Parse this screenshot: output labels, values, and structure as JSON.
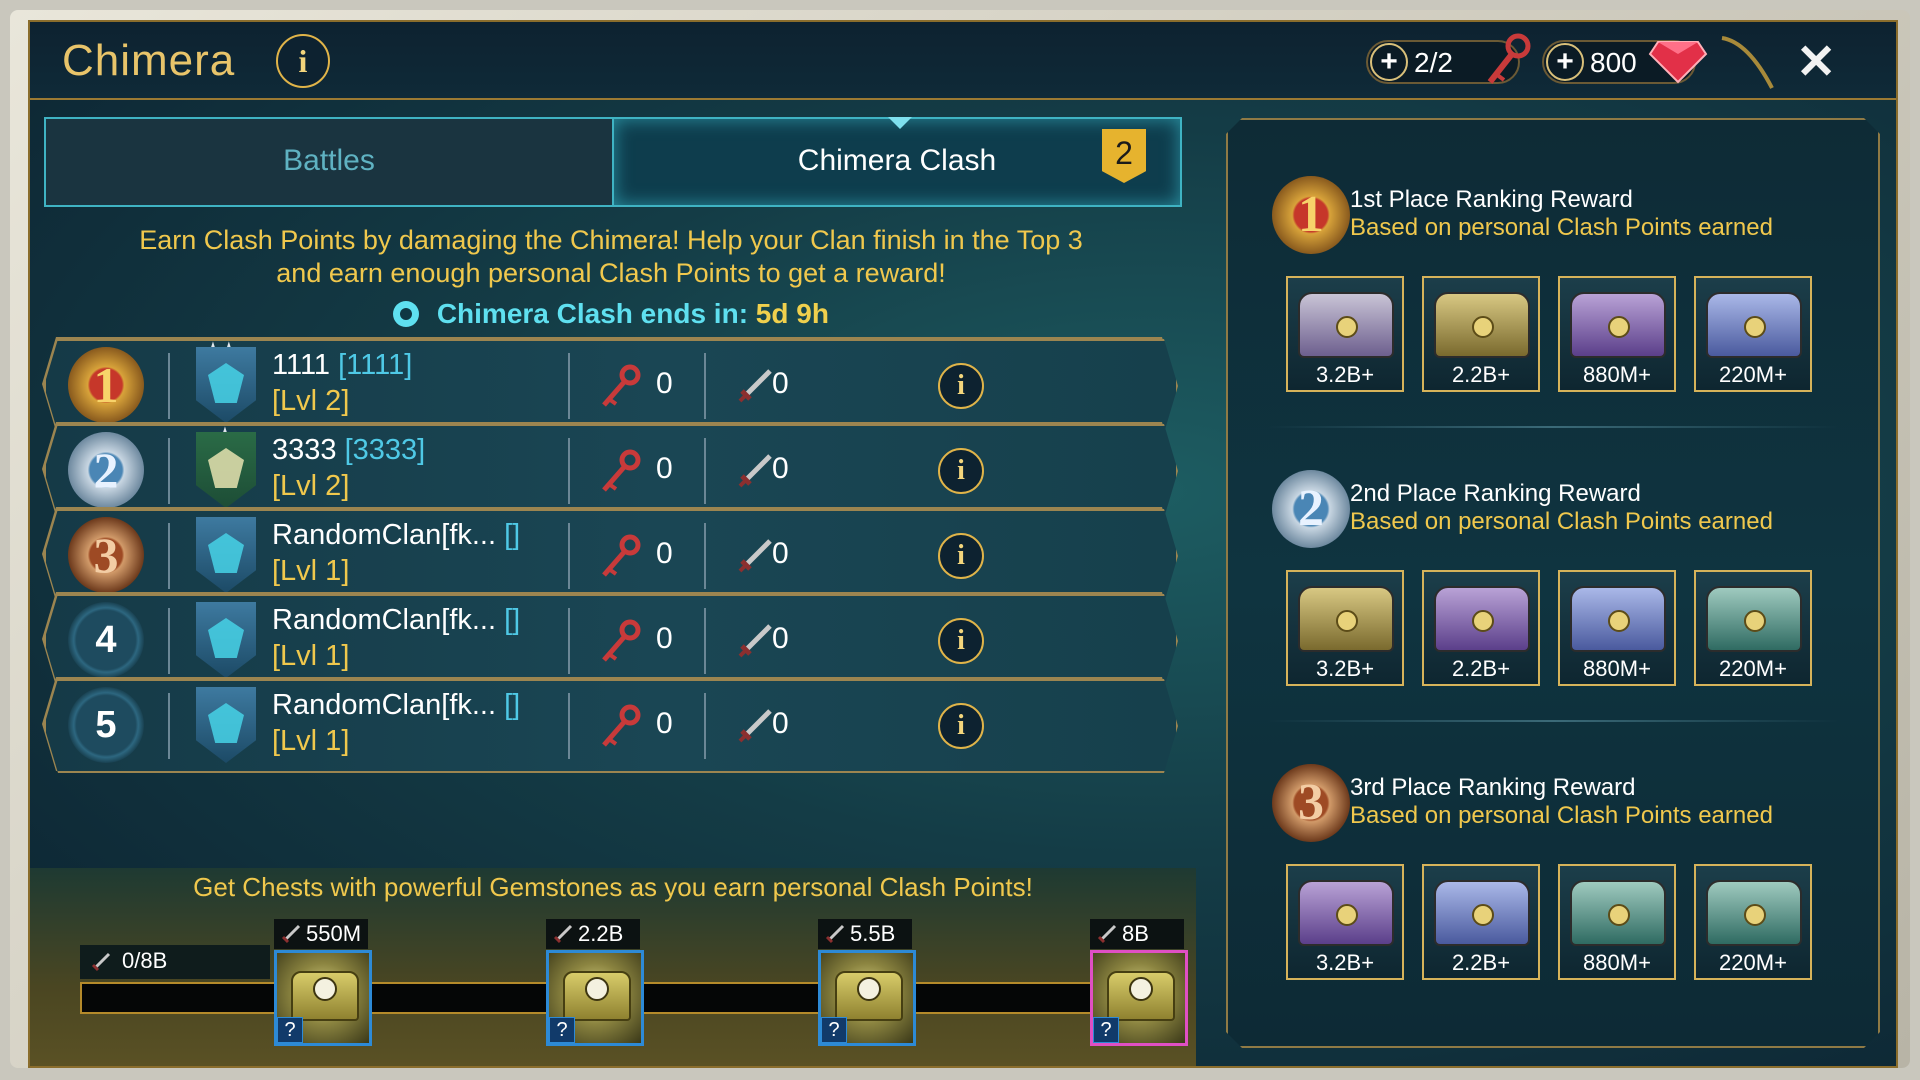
{
  "header": {
    "title": "Chimera",
    "keys": "2/2",
    "gems": "800",
    "close": "✕"
  },
  "tabs": {
    "battles": "Battles",
    "clash": "Chimera Clash",
    "clash_badge": "2"
  },
  "description": {
    "line1": "Earn Clash Points by damaging the Chimera! Help your Clan finish in the Top 3",
    "line2": "and earn enough personal Clash Points to get a reward!"
  },
  "timer": {
    "label": "Chimera Clash ends in:",
    "value": "5d 9h"
  },
  "clans": [
    {
      "rank": "1",
      "name": "1111",
      "tag": "[1111]",
      "level": "[Lvl 2]",
      "keys": "0",
      "points": "0"
    },
    {
      "rank": "2",
      "name": "3333",
      "tag": "[3333]",
      "level": "[Lvl 2]",
      "keys": "0",
      "points": "0"
    },
    {
      "rank": "3",
      "name": "RandomClan[fk...",
      "tag": "[]",
      "level": "[Lvl 1]",
      "keys": "0",
      "points": "0"
    },
    {
      "rank": "4",
      "name": "RandomClan[fk...",
      "tag": "[]",
      "level": "[Lvl 1]",
      "keys": "0",
      "points": "0"
    },
    {
      "rank": "5",
      "name": "RandomClan[fk...",
      "tag": "[]",
      "level": "[Lvl 1]",
      "keys": "0",
      "points": "0"
    }
  ],
  "progress": {
    "caption": "Get Chests with powerful Gemstones as you earn personal Clash Points!",
    "current": "0/8B",
    "fraction": 0,
    "milestones": [
      "550M",
      "2.2B",
      "5.5B",
      "8B"
    ],
    "chest_unknown": "?"
  },
  "rewards": [
    {
      "medal": "1",
      "title": "1st Place Ranking Reward",
      "subtitle": "Based on personal Clash Points earned",
      "amounts": [
        "3.2B+",
        "2.2B+",
        "880M+",
        "220M+"
      ]
    },
    {
      "medal": "2",
      "title": "2nd Place Ranking Reward",
      "subtitle": "Based on personal Clash Points earned",
      "amounts": [
        "3.2B+",
        "2.2B+",
        "880M+",
        "220M+"
      ]
    },
    {
      "medal": "3",
      "title": "3rd Place Ranking Reward",
      "subtitle": "Based on personal Clash Points earned",
      "amounts": [
        "3.2B+",
        "2.2B+",
        "880M+",
        "220M+"
      ]
    }
  ],
  "colors": {
    "gold": "#f0c84d",
    "cyan": "#4fc9e6",
    "legendary_chest": "#b8a04a",
    "mythic_chest": "#8a6bbf",
    "epic_chest": "#5a6fbf",
    "rare_chest": "#3f7f7a"
  }
}
